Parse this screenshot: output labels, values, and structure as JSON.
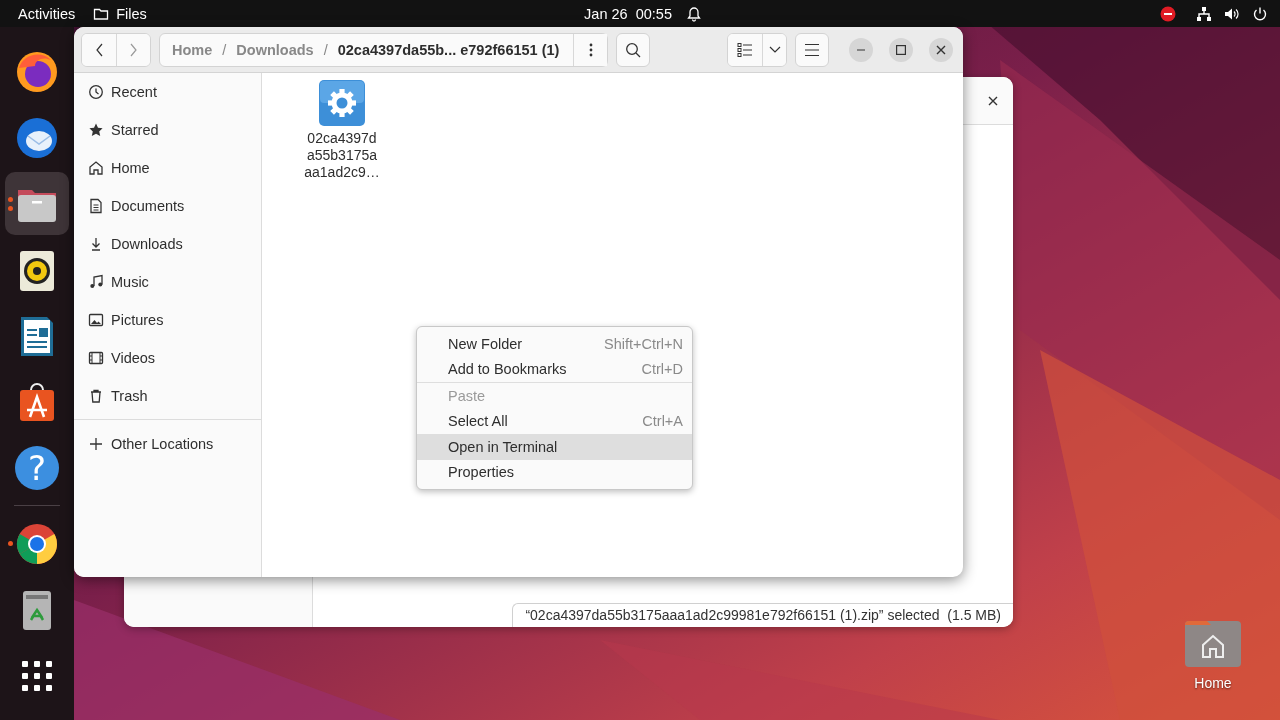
{
  "top_bar": {
    "activities": "Activities",
    "app": "Files",
    "clock": "Jan 26  00:55"
  },
  "dock": [
    {
      "kind": "firefox",
      "running": false,
      "multi_window": false,
      "selected": false
    },
    {
      "kind": "thunderbird",
      "running": false,
      "multi_window": false,
      "selected": false
    },
    {
      "kind": "files",
      "running": true,
      "multi_window": true,
      "selected": true
    },
    {
      "kind": "rhythmbox",
      "running": false,
      "multi_window": false,
      "selected": false
    },
    {
      "kind": "writer",
      "running": false,
      "multi_window": false,
      "selected": false
    },
    {
      "kind": "appcenter",
      "running": false,
      "multi_window": false,
      "selected": false
    },
    {
      "kind": "help",
      "glyph": "?",
      "running": false,
      "multi_window": false,
      "selected": false
    },
    {
      "kind": "separator"
    },
    {
      "kind": "chrome",
      "running": true,
      "multi_window": false,
      "selected": false
    },
    {
      "kind": "trash",
      "running": false,
      "multi_window": false,
      "selected": false
    },
    {
      "kind": "apps",
      "running": false,
      "multi_window": false,
      "selected": false
    }
  ],
  "back_window": {
    "status": "“02ca4397da55b3175aaa1ad2c99981e792f66151 (1).zip” selected  (1.5 MB)"
  },
  "desktop_icons": [
    {
      "label": "Home"
    }
  ],
  "window": {
    "path": [
      {
        "label": "Home",
        "current": false
      },
      {
        "kind": "separator",
        "label": "/"
      },
      {
        "label": "Downloads",
        "current": false
      },
      {
        "kind": "separator",
        "label": "/"
      },
      {
        "label": "02ca4397da55b... e792f66151 (1)",
        "current": true
      }
    ],
    "sidebar": [
      {
        "kind": "recent",
        "label": "Recent"
      },
      {
        "kind": "starred",
        "label": "Starred"
      },
      {
        "kind": "home",
        "label": "Home"
      },
      {
        "kind": "documents",
        "label": "Documents"
      },
      {
        "kind": "downloads",
        "label": "Downloads"
      },
      {
        "kind": "music",
        "label": "Music"
      },
      {
        "kind": "pictures",
        "label": "Pictures"
      },
      {
        "kind": "videos",
        "label": "Videos"
      },
      {
        "kind": "trash",
        "label": "Trash"
      },
      {
        "kind": "other",
        "label": "Other Locations"
      }
    ],
    "files": [
      {
        "name": "02ca4397d\na55b3175a\naa1ad2c9…"
      }
    ]
  },
  "context_menu": [
    {
      "label": "New Folder",
      "shortcut": "Shift+Ctrl+N",
      "disabled": false,
      "selected": false
    },
    {
      "label": "Add to Bookmarks",
      "shortcut": "Ctrl+D",
      "disabled": false,
      "selected": false
    },
    {
      "kind": "separator"
    },
    {
      "label": "Paste",
      "disabled": true,
      "selected": false
    },
    {
      "label": "Select All",
      "shortcut": "Ctrl+A",
      "disabled": false,
      "selected": false
    },
    {
      "label": "Open in Terminal",
      "disabled": false,
      "selected": true
    },
    {
      "label": "Properties",
      "disabled": false,
      "selected": false
    }
  ]
}
